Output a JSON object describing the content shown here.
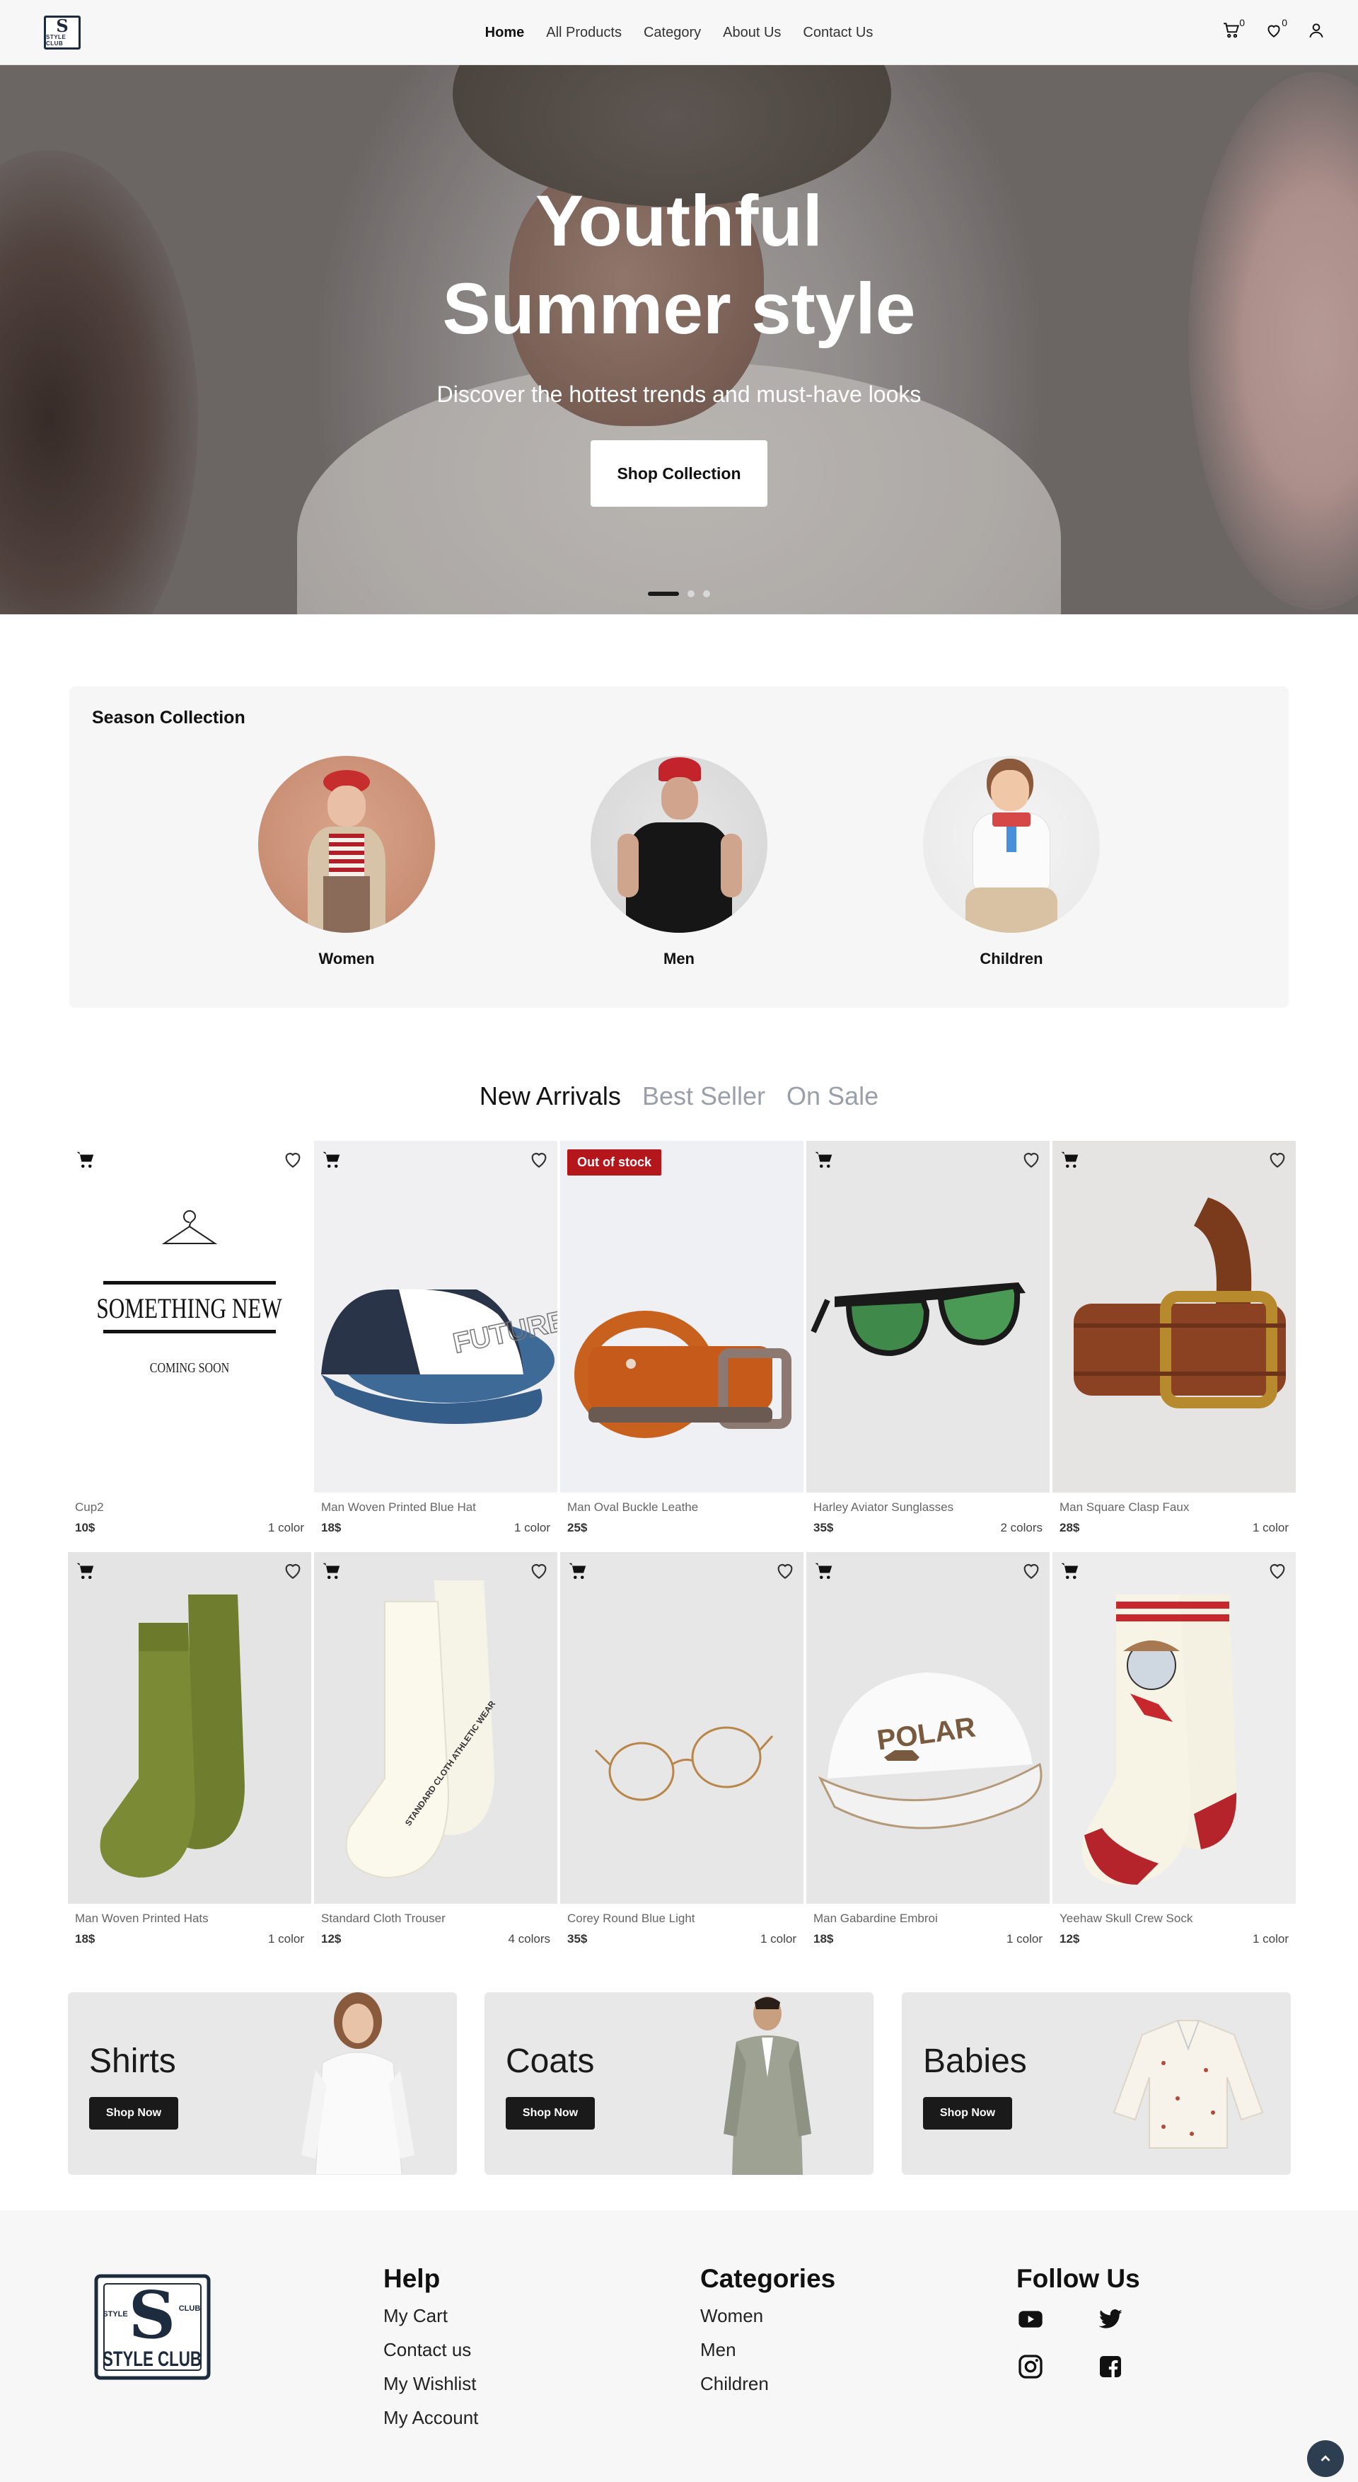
{
  "brand": {
    "logo_text": "STYLE CLUB",
    "logo_letter": "S",
    "logo_small_text": "STYLE",
    "logo_small_text2": "CLUB"
  },
  "nav": {
    "links": [
      {
        "label": "Home",
        "active": true
      },
      {
        "label": "All Products",
        "active": false
      },
      {
        "label": "Category",
        "active": false
      },
      {
        "label": "About Us",
        "active": false
      },
      {
        "label": "Contact Us",
        "active": false
      }
    ],
    "cart_icon": "cart-icon",
    "cart_count": "0",
    "wishlist_icon": "heart-icon",
    "wishlist_count": "0",
    "account_icon": "user-icon"
  },
  "hero": {
    "title_line1": "Youthful",
    "title_line2": "Summer style",
    "subtitle": "Discover the hottest trends and must-have looks",
    "button": "Shop Collection",
    "slide_count": 3,
    "active_slide": 1
  },
  "season": {
    "title": "Season Collection",
    "items": [
      {
        "name": "Women"
      },
      {
        "name": "Men"
      },
      {
        "name": "Children"
      }
    ]
  },
  "tabs": [
    {
      "label": "New Arrivals",
      "active": true
    },
    {
      "label": "Best Seller",
      "active": false
    },
    {
      "label": "On Sale",
      "active": false
    }
  ],
  "products": [
    {
      "name": "Cup2",
      "price": "10$",
      "colors": "1 color",
      "out_of_stock": false,
      "image": "coming-soon"
    },
    {
      "name": "Man Woven Printed Blue Hat",
      "price": "18$",
      "colors": "1 color",
      "out_of_stock": false,
      "image": "cap-blue"
    },
    {
      "name": "Man Oval Buckle Leathe",
      "price": "25$",
      "colors": "",
      "out_of_stock": true,
      "badge": "Out of stock",
      "image": "belt-orange"
    },
    {
      "name": "Harley Aviator Sunglasses",
      "price": "35$",
      "colors": "2 colors",
      "out_of_stock": false,
      "image": "sunglasses"
    },
    {
      "name": "Man Square Clasp Faux",
      "price": "28$",
      "colors": "1 color",
      "out_of_stock": false,
      "image": "belt-brown"
    },
    {
      "name": "Man Woven Printed Hats",
      "price": "18$",
      "colors": "1 color",
      "out_of_stock": false,
      "image": "socks-green"
    },
    {
      "name": "Standard Cloth Trouser",
      "price": "12$",
      "colors": "4 colors",
      "out_of_stock": false,
      "image": "socks-white"
    },
    {
      "name": "Corey Round Blue Light",
      "price": "35$",
      "colors": "1 color",
      "out_of_stock": false,
      "image": "glasses"
    },
    {
      "name": "Man Gabardine Embroi",
      "price": "18$",
      "colors": "1 color",
      "out_of_stock": false,
      "image": "cap-white"
    },
    {
      "name": "Yeehaw Skull Crew Sock",
      "price": "12$",
      "colors": "1 color",
      "out_of_stock": false,
      "image": "sock-skull"
    }
  ],
  "coming_soon": {
    "line1": "SOMETHING NEW",
    "line2": "COMING SOON"
  },
  "cap_print": "FUTURE",
  "cap_white_print": "POLAR",
  "sock_print": "STANDARD CLOTH ATHLETIC WEAR",
  "promos": [
    {
      "title": "Shirts",
      "button": "Shop Now"
    },
    {
      "title": "Coats",
      "button": "Shop Now"
    },
    {
      "title": "Babies",
      "button": "Shop Now"
    }
  ],
  "footer": {
    "help": {
      "title": "Help",
      "links": [
        "My Cart",
        "Contact us",
        "My Wishlist",
        "My Account"
      ]
    },
    "categories": {
      "title": "Categories",
      "links": [
        "Women",
        "Men",
        "Children"
      ]
    },
    "follow": {
      "title": "Follow Us",
      "icons": [
        "youtube-icon",
        "twitter-icon",
        "instagram-icon",
        "facebook-icon"
      ]
    }
  },
  "colors": {
    "nav_bg": "#f7f7f7",
    "badge_red": "#b5161b",
    "dark": "#1a1a1a",
    "scroll_btn": "#2c3e50"
  }
}
